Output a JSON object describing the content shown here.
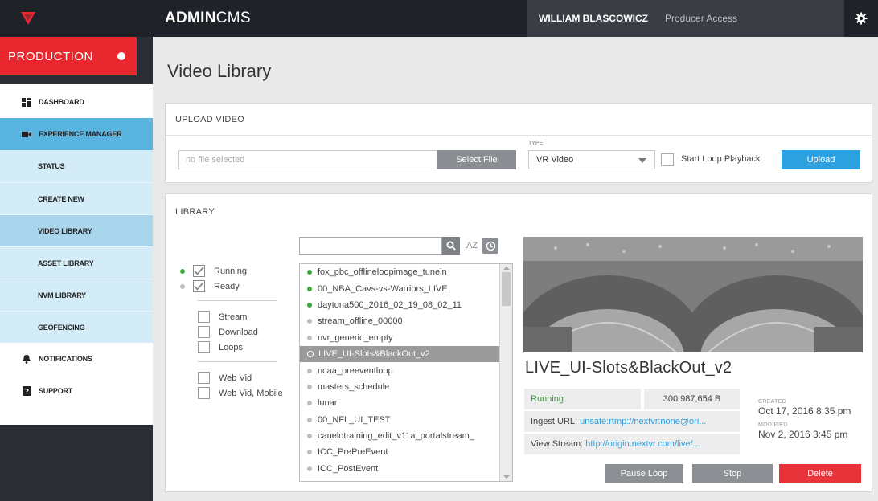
{
  "header": {
    "app_title_bold": "ADMIN",
    "app_title_light": "CMS",
    "user_name": "WILLIAM BLASCOWICZ",
    "user_role": "Producer Access"
  },
  "sidebar": {
    "environment": "PRODUCTION",
    "items": [
      {
        "label": "DASHBOARD",
        "icon": "dashboard-icon"
      },
      {
        "label": "EXPERIENCE MANAGER",
        "icon": "video-camera-icon"
      },
      {
        "label": "STATUS"
      },
      {
        "label": "CREATE NEW"
      },
      {
        "label": "VIDEO LIBRARY"
      },
      {
        "label": "ASSET LIBRARY"
      },
      {
        "label": "NVM LIBRARY"
      },
      {
        "label": "GEOFENCING"
      },
      {
        "label": "NOTIFICATIONS",
        "icon": "bell-icon"
      },
      {
        "label": "SUPPORT",
        "icon": "help-icon"
      }
    ]
  },
  "page": {
    "title": "Video Library"
  },
  "upload": {
    "heading": "UPLOAD VIDEO",
    "file_placeholder": "no file selected",
    "select_file_label": "Select File",
    "type_label": "TYPE",
    "type_value": "VR Video",
    "loop_label": "Start Loop Playback",
    "upload_label": "Upload"
  },
  "library": {
    "heading": "LIBRARY",
    "sort_label": "AZ",
    "filters": {
      "status": [
        {
          "label": "Running",
          "color": "#3aa83a",
          "checked": true
        },
        {
          "label": "Ready",
          "color": "#bdbdbd",
          "checked": true
        }
      ],
      "kind": [
        "Stream",
        "Download",
        "Loops"
      ],
      "platform": [
        "Web Vid",
        "Web Vid, Mobile"
      ]
    },
    "videos": [
      {
        "name": "fox_pbc_offlineloopimage_tunein",
        "status": "running"
      },
      {
        "name": "00_NBA_Cavs-vs-Warriors_LIVE",
        "status": "running"
      },
      {
        "name": "daytona500_2016_02_19_08_02_11",
        "status": "running"
      },
      {
        "name": "stream_offline_00000",
        "status": "ready"
      },
      {
        "name": "nvr_generic_empty",
        "status": "ready"
      },
      {
        "name": "LIVE_UI-Slots&BlackOut_v2",
        "status": "selected"
      },
      {
        "name": "ncaa_preeventloop",
        "status": "ready"
      },
      {
        "name": "masters_schedule",
        "status": "ready"
      },
      {
        "name": "lunar",
        "status": "ready"
      },
      {
        "name": "00_NFL_UI_TEST",
        "status": "ready"
      },
      {
        "name": "canelotraining_edit_v11a_portalstream_",
        "status": "ready"
      },
      {
        "name": "ICC_PrePreEvent",
        "status": "ready"
      },
      {
        "name": "ICC_PostEvent",
        "status": "ready"
      }
    ],
    "colors": {
      "running": "#3aa83a",
      "ready": "#bdbdbd"
    }
  },
  "detail": {
    "title": "LIVE_UI-Slots&BlackOut_v2",
    "status": "Running",
    "size": "300,987,654 B",
    "ingest_label": "Ingest URL:",
    "ingest_url": "unsafe:rtmp://nextvr:none@ori...",
    "view_label": "View Stream:",
    "view_url": "http://origin.nextvr.com/live/...",
    "created_label": "CREATED",
    "created_value": "Oct 17, 2016  8:35 pm",
    "modified_label": "MODIFIED",
    "modified_value": "Nov 2, 2016  3:45 pm",
    "pause_label": "Pause Loop",
    "stop_label": "Stop",
    "delete_label": "Delete"
  }
}
